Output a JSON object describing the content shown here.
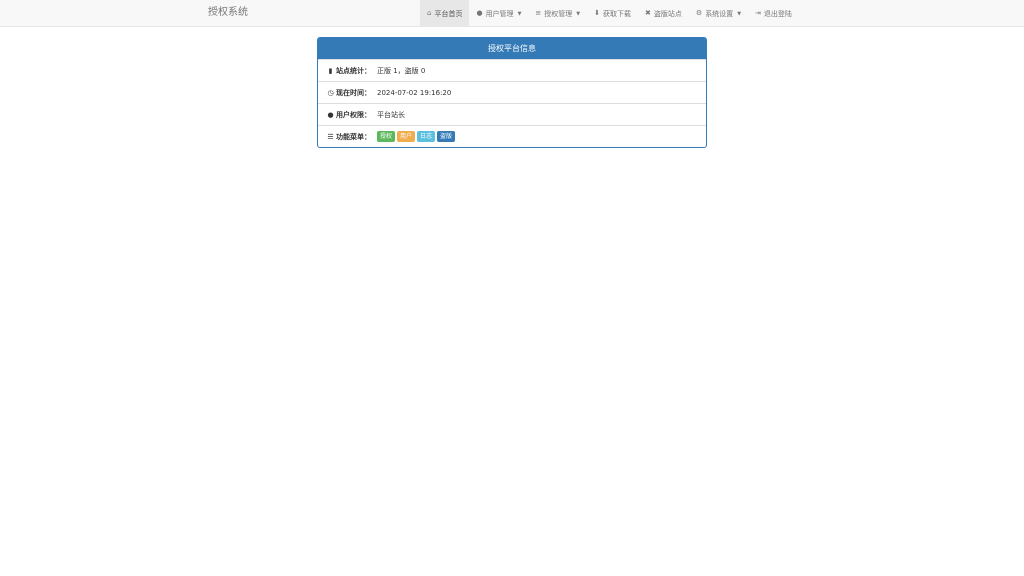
{
  "navbar": {
    "brand": "授权系统",
    "items": [
      {
        "icon": "home-icon",
        "glyph": "⌂",
        "label": "平台首页",
        "dropdown": false,
        "active": true
      },
      {
        "icon": "user-icon",
        "glyph": "●",
        "label": "用户管理",
        "dropdown": true,
        "active": false
      },
      {
        "icon": "list-icon",
        "glyph": "≡",
        "label": "授权管理",
        "dropdown": true,
        "active": false
      },
      {
        "icon": "download-icon",
        "glyph": "⬇",
        "label": "获取下载",
        "dropdown": false,
        "active": false
      },
      {
        "icon": "close-icon",
        "glyph": "✖",
        "label": "盗版站点",
        "dropdown": false,
        "active": false
      },
      {
        "icon": "gear-icon",
        "glyph": "⚙",
        "label": "系统设置",
        "dropdown": true,
        "active": false
      },
      {
        "icon": "logout-icon",
        "glyph": "⇥",
        "label": "退出登陆",
        "dropdown": false,
        "active": false
      }
    ]
  },
  "panel": {
    "title": "授权平台信息",
    "rows": [
      {
        "icon": "stats-icon",
        "glyph": "▮",
        "label": "站点统计：",
        "value": "正版 1，盗版 0"
      },
      {
        "icon": "clock-icon",
        "glyph": "◷",
        "label": "现在时间：",
        "value": "2024-07-02 19:16:20"
      },
      {
        "icon": "drop-icon",
        "glyph": "●",
        "label": "用户权限：",
        "value": "平台站长"
      },
      {
        "icon": "menu-list-icon",
        "glyph": "☰",
        "label": "功能菜单：",
        "value": ""
      }
    ],
    "menu_buttons": [
      {
        "label": "授权",
        "color": "#5cb85c"
      },
      {
        "label": "用户",
        "color": "#f0ad4e"
      },
      {
        "label": "日志",
        "color": "#5bc0de"
      },
      {
        "label": "盗版",
        "color": "#337ab7"
      }
    ]
  }
}
